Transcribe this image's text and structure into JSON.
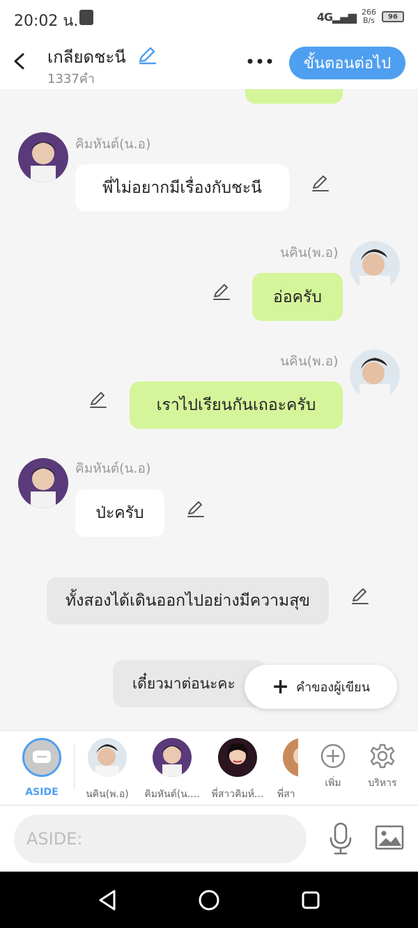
{
  "status": {
    "time": "20:02 น.",
    "signal": "4G",
    "speed_value": "266",
    "speed_unit": "B/s",
    "battery": "96"
  },
  "header": {
    "title": "เกลียดชะนี",
    "subtitle": "1337คำ",
    "next_label": "ขั้นตอนต่อไป"
  },
  "messages": [
    {
      "side": "left",
      "sender": "คิมหันต์(น.อ)",
      "text": "พี่ไม่อยากมีเรื่องกับชะนี"
    },
    {
      "side": "right",
      "sender": "นคิน(พ.อ)",
      "text": "อ่อครับ"
    },
    {
      "side": "right",
      "sender": "นคิน(พ.อ)",
      "text": "เราไปเรียนกันเถอะครับ"
    },
    {
      "side": "left",
      "sender": "คิมหันต์(น.อ)",
      "text": "ป่ะครับ"
    },
    {
      "side": "narration",
      "text": "ทั้งสองได้เดินออกไปอย่างมีความสุข"
    },
    {
      "side": "narration",
      "text": "เดี๋ยวมาต่อนะคะ"
    }
  ],
  "fab": {
    "label": "คำของผู้เขียน"
  },
  "characters": {
    "aside_label": "ASIDE",
    "items": [
      "นคิน(พ.อ)",
      "คิมหันต์(น....",
      "พี่สาวคิมห์...",
      "พี่สา"
    ],
    "add_label": "เพิ่ม",
    "manage_label": "บริหาร"
  },
  "input": {
    "placeholder": "ASIDE:"
  },
  "colors": {
    "accent": "#4f9ff0",
    "bubble_right": "#d5f59a",
    "bubble_left": "#ffffff",
    "narration": "#e8e8e8"
  },
  "icons": [
    "back-arrow-icon",
    "pencil-icon",
    "more-dots-icon",
    "plus-icon",
    "add-circle-icon",
    "gear-icon",
    "microphone-icon",
    "image-icon"
  ]
}
